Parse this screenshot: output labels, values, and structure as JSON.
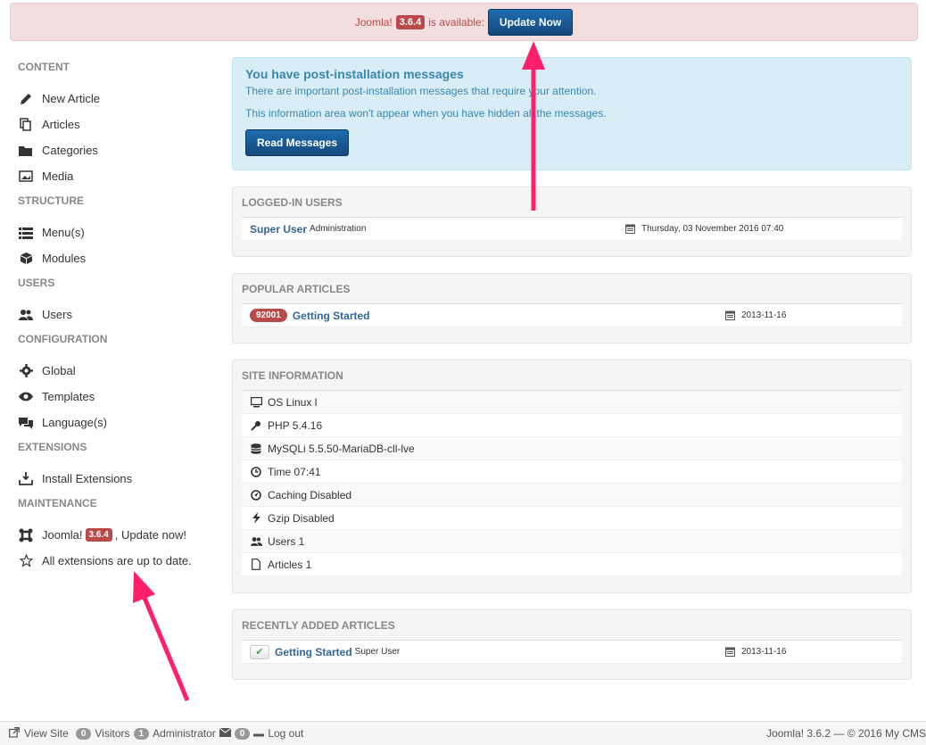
{
  "update_bar": {
    "prefix": "Joomla!",
    "version": "3.6.4",
    "suffix": "is available:",
    "button_label": "Update Now"
  },
  "sidebar": {
    "sections": [
      {
        "title": "CONTENT",
        "items": [
          {
            "label": "New Article",
            "icon": "pencil-icon"
          },
          {
            "label": "Articles",
            "icon": "copy-icon"
          },
          {
            "label": "Categories",
            "icon": "folder-icon"
          },
          {
            "label": "Media",
            "icon": "image-icon"
          }
        ]
      },
      {
        "title": "STRUCTURE",
        "items": [
          {
            "label": "Menu(s)",
            "icon": "list-icon"
          },
          {
            "label": "Modules",
            "icon": "cube-icon"
          }
        ]
      },
      {
        "title": "USERS",
        "items": [
          {
            "label": "Users",
            "icon": "users-icon"
          }
        ]
      },
      {
        "title": "CONFIGURATION",
        "items": [
          {
            "label": "Global",
            "icon": "cog-icon"
          },
          {
            "label": "Templates",
            "icon": "eye-icon"
          },
          {
            "label": "Language(s)",
            "icon": "comments-icon"
          }
        ]
      },
      {
        "title": "EXTENSIONS",
        "items": [
          {
            "label": "Install Extensions",
            "icon": "upload-icon"
          }
        ]
      },
      {
        "title": "MAINTENANCE",
        "items": [
          {
            "label": "Joomla!",
            "icon": "joomla-icon",
            "badge": "3.6.4",
            "label_after": ", Update now!"
          },
          {
            "label": "All extensions are up to date.",
            "icon": "star-icon"
          }
        ]
      }
    ]
  },
  "post_install": {
    "title": "You have post-installation messages",
    "line1": "There are important post-installation messages that require your attention.",
    "line2": "This information area won't appear when you have hidden all the messages.",
    "button_label": "Read Messages"
  },
  "logged_in_users": {
    "title": "LOGGED-IN USERS",
    "rows": [
      {
        "name": "Super User",
        "role": "Administration",
        "date": "Thursday, 03 November 2016 07:40"
      }
    ]
  },
  "popular_articles": {
    "title": "POPULAR ARTICLES",
    "rows": [
      {
        "hits": "92001",
        "title": "Getting Started",
        "date": "2013-11-16"
      }
    ]
  },
  "site_information": {
    "title": "SITE INFORMATION",
    "rows": [
      {
        "icon": "monitor-icon",
        "text": "OS Linux l"
      },
      {
        "icon": "key-icon",
        "text": "PHP 5.4.16"
      },
      {
        "icon": "database-icon",
        "text": "MySQLi 5.5.50-MariaDB-cll-lve"
      },
      {
        "icon": "clock-icon",
        "text": "Time 07:41"
      },
      {
        "icon": "dashboard-icon",
        "text": "Caching Disabled"
      },
      {
        "icon": "lightning-icon",
        "text": "Gzip Disabled"
      },
      {
        "icon": "users-icon",
        "text": "Users 1"
      },
      {
        "icon": "file-icon",
        "text": "Articles 1"
      }
    ]
  },
  "recent_articles": {
    "title": "RECENTLY ADDED ARTICLES",
    "rows": [
      {
        "title": "Getting Started",
        "author": "Super User",
        "date": "2013-11-16"
      }
    ]
  },
  "footer": {
    "view_site": "View Site",
    "visitors_count": "0",
    "visitors_label": "Visitors",
    "admin_count": "1",
    "admin_label": "Administrator",
    "messages_count": "0",
    "logout": "Log out",
    "copyright": "Joomla! 3.6.2 — © 2016 My CMS"
  },
  "colors": {
    "accent_blue": "#15497c",
    "badge_red": "#b94a48",
    "arrow_pink": "#ff1f6b"
  }
}
